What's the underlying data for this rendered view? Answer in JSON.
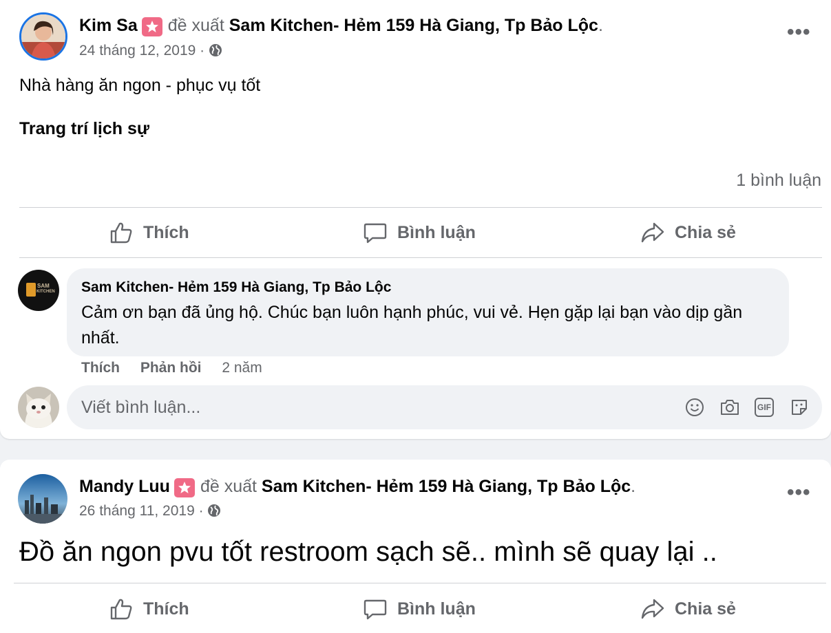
{
  "colors": {
    "page_bg": "#f0f2f5",
    "card_bg": "#ffffff",
    "muted_text": "#65676b",
    "badge": "#f06a86",
    "avatar_ring": "#1b74e4"
  },
  "posts": [
    {
      "author": "Kim Sa",
      "recommend_text": "đề xuất",
      "page_name": "Sam Kitchen- Hẻm 159 Hà Giang, Tp Bảo Lộc",
      "period": ".",
      "date": "24 tháng 12, 2019",
      "separator": "·",
      "body_line1": "Nhà hàng ăn ngon - phục vụ tốt",
      "body_line2": "Trang trí lịch sự",
      "comment_count": "1 bình luận",
      "actions": {
        "like": "Thích",
        "comment": "Bình luận",
        "share": "Chia sẻ"
      },
      "more_icon": "more-options-icon",
      "reply": {
        "author": "Sam Kitchen- Hẻm 159 Hà Giang, Tp Bảo Lộc",
        "text": "Cảm ơn bạn đã ủng hộ. Chúc bạn luôn hạnh phúc, vui vẻ. Hẹn gặp lại bạn vào dịp gần nhất.",
        "logo_text_top": "SAM",
        "logo_text_bottom": "KITCHEN",
        "like": "Thích",
        "reply_label": "Phản hồi",
        "age": "2 năm"
      },
      "composer": {
        "placeholder": "Viết bình luận...",
        "icons": [
          "emoji-icon",
          "camera-icon",
          "gif-icon",
          "sticker-icon"
        ],
        "gif_text": "GIF"
      }
    },
    {
      "author": "Mandy Luu",
      "recommend_text": "đề xuất",
      "page_name": "Sam Kitchen- Hẻm 159 Hà Giang, Tp Bảo Lộc",
      "period": ".",
      "date": "26 tháng 11, 2019",
      "separator": "·",
      "body": "Đồ ăn ngon pvu tốt restroom sạch sẽ.. mình sẽ quay lại ..",
      "actions": {
        "like": "Thích",
        "comment": "Bình luận",
        "share": "Chia sẻ"
      },
      "more_icon": "more-options-icon"
    }
  ]
}
